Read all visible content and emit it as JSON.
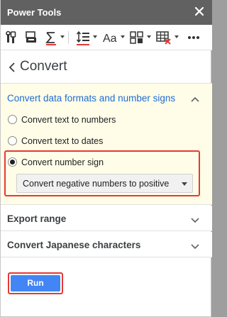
{
  "window": {
    "title": "Power Tools"
  },
  "header": {
    "title": "Convert"
  },
  "sections": {
    "active": {
      "title": "Convert data formats and number signs",
      "options": [
        {
          "label": "Convert text to numbers",
          "selected": false
        },
        {
          "label": "Convert text to dates",
          "selected": false
        },
        {
          "label": "Convert number sign",
          "selected": true
        }
      ],
      "select_value": "Convert negative numbers to positive"
    },
    "export_range": {
      "title": "Export range"
    },
    "japanese": {
      "title": "Convert Japanese characters"
    }
  },
  "run": {
    "label": "Run"
  },
  "toolbar": {
    "icons": [
      "tools-icon",
      "trash-clear-icon",
      "sum-icon",
      "line-spacing-icon",
      "text-case-icon",
      "merge-icon",
      "table-delete-icon",
      "more-icon"
    ],
    "accent": "#e53935"
  },
  "colors": {
    "link": "#1e6bd6",
    "highlight": "#e53935",
    "run": "#4285f4",
    "titlebar": "#616161"
  }
}
